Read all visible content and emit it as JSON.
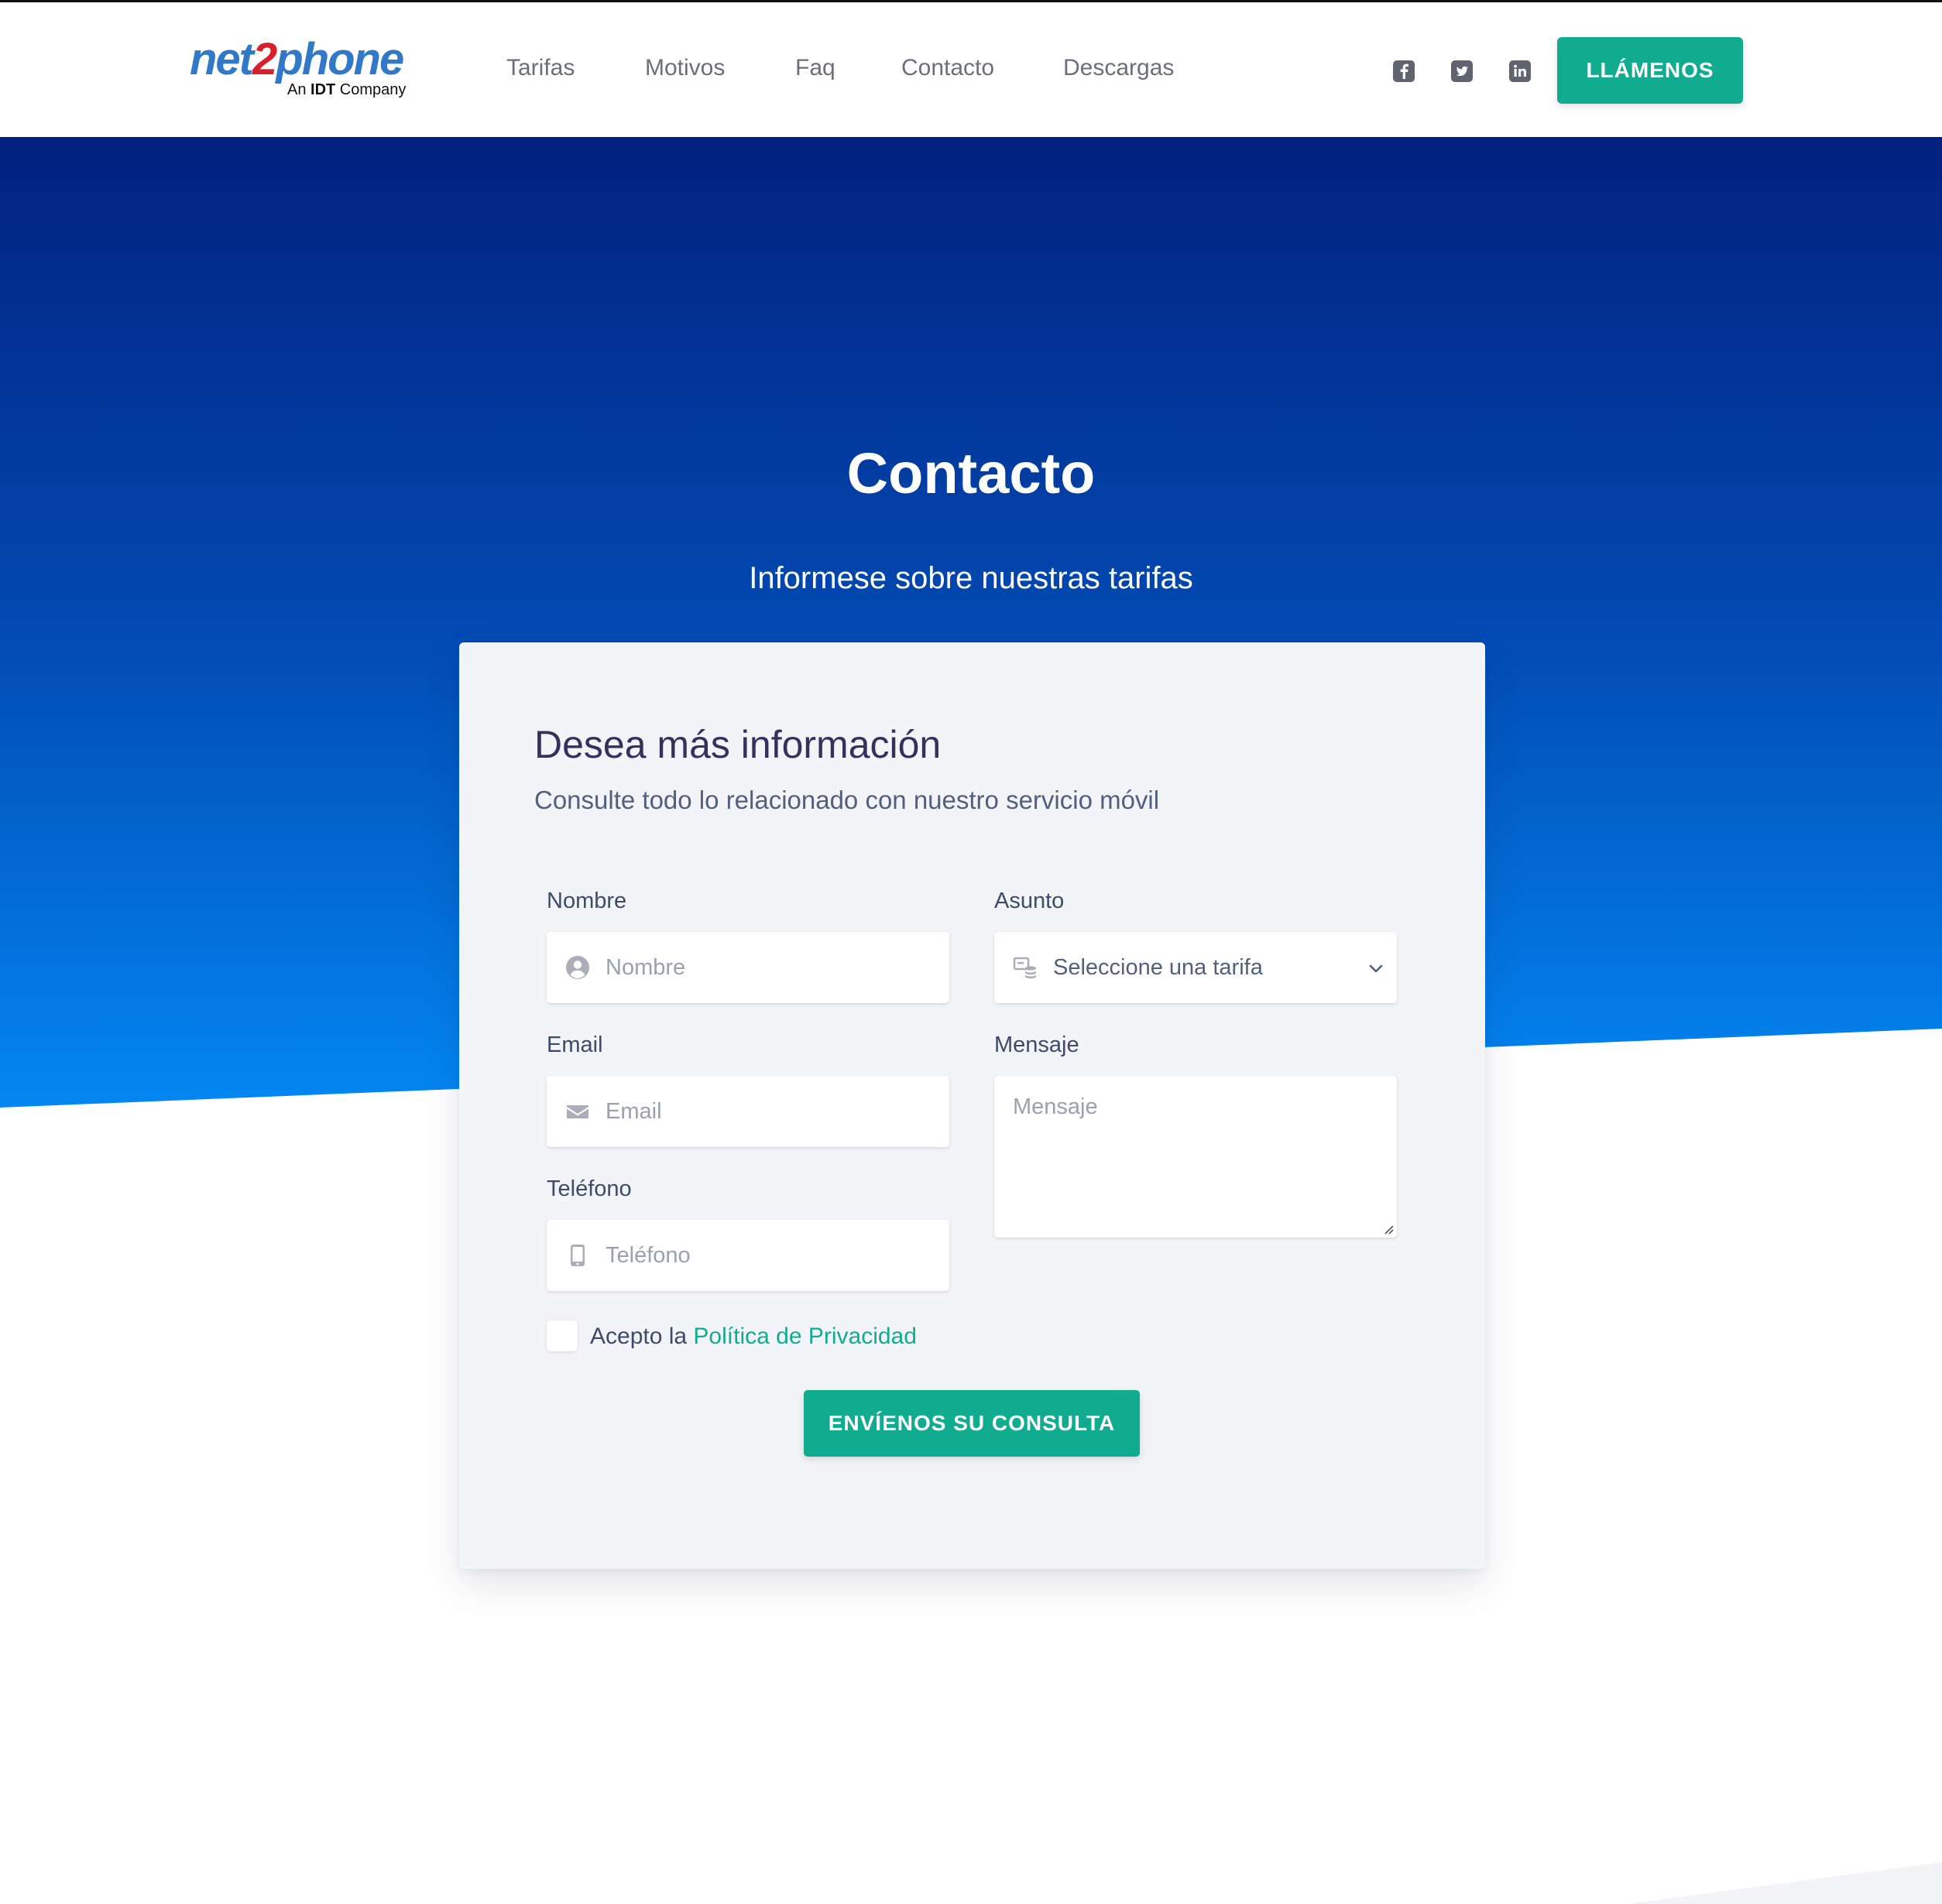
{
  "header": {
    "logo": {
      "brand_main": "net",
      "brand_two": "2",
      "brand_end": "phone",
      "tagline_prefix": "An ",
      "tagline_bold": "IDT",
      "tagline_suffix": " Company"
    },
    "nav": [
      {
        "label": "Tarifas"
      },
      {
        "label": "Motivos"
      },
      {
        "label": "Faq"
      },
      {
        "label": "Contacto"
      },
      {
        "label": "Descargas"
      }
    ],
    "social": [
      "facebook-icon",
      "twitter-icon",
      "linkedin-icon"
    ],
    "call_button": "LLÁMENOS"
  },
  "hero": {
    "title": "Contacto",
    "subtitle": "Informese sobre nuestras tarifas"
  },
  "form": {
    "title": "Desea más información",
    "subtitle": "Consulte todo lo relacionado con nuestro servicio móvil",
    "nombre": {
      "label": "Nombre",
      "placeholder": "Nombre",
      "value": ""
    },
    "email": {
      "label": "Email",
      "placeholder": "Email",
      "value": ""
    },
    "telefono": {
      "label": "Teléfono",
      "placeholder": "Teléfono",
      "value": ""
    },
    "asunto": {
      "label": "Asunto",
      "selected": "Seleccione una tarifa"
    },
    "mensaje": {
      "label": "Mensaje",
      "placeholder": "Mensaje",
      "value": ""
    },
    "privacy": {
      "prefix": "Acepto la ",
      "link": "Política de Privacidad",
      "checked": false
    },
    "submit": "ENVÍENOS SU CONSULTA"
  },
  "colors": {
    "accent": "#11ab8f",
    "hero_top": "#01217f",
    "hero_bottom": "#0382f0",
    "card_bg": "#f3f4f7"
  }
}
